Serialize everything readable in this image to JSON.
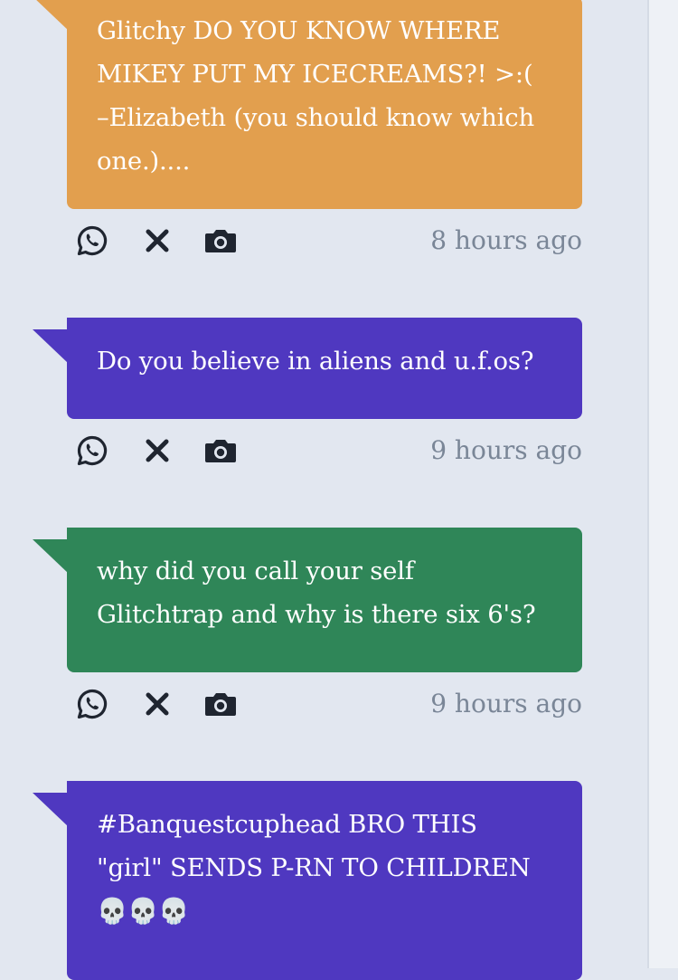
{
  "colors": {
    "orange": "#e29f4e",
    "purple": "#4f38c0",
    "green": "#2f8658",
    "icon": "#1f2530",
    "time": "#7a8697",
    "background": "#e2e7f0"
  },
  "icons": {
    "share_whatsapp": "whatsapp-icon",
    "share_x": "x-icon",
    "screenshot": "camera-icon"
  },
  "messages": [
    {
      "color": "orange",
      "lines": [
        "Glitchy DO YOU KNOW WHERE",
        "MIKEY PUT MY ICECREAMS?! >:(",
        "–Elizabeth (you should know which",
        "one.)...."
      ],
      "time": "8 hours ago"
    },
    {
      "color": "purple",
      "lines": [
        "Do you believe in aliens and u.f.os?"
      ],
      "time": "9 hours ago"
    },
    {
      "color": "green",
      "lines": [
        "why did you call your self",
        "Glitchtrap and why is there six 6's?"
      ],
      "time": "9 hours ago"
    },
    {
      "color": "purple",
      "lines": [
        "#Banquestcuphead BRO THIS",
        "\"girl\" SENDS P-RN TO CHILDREN",
        "💀💀💀"
      ],
      "time": ""
    }
  ]
}
